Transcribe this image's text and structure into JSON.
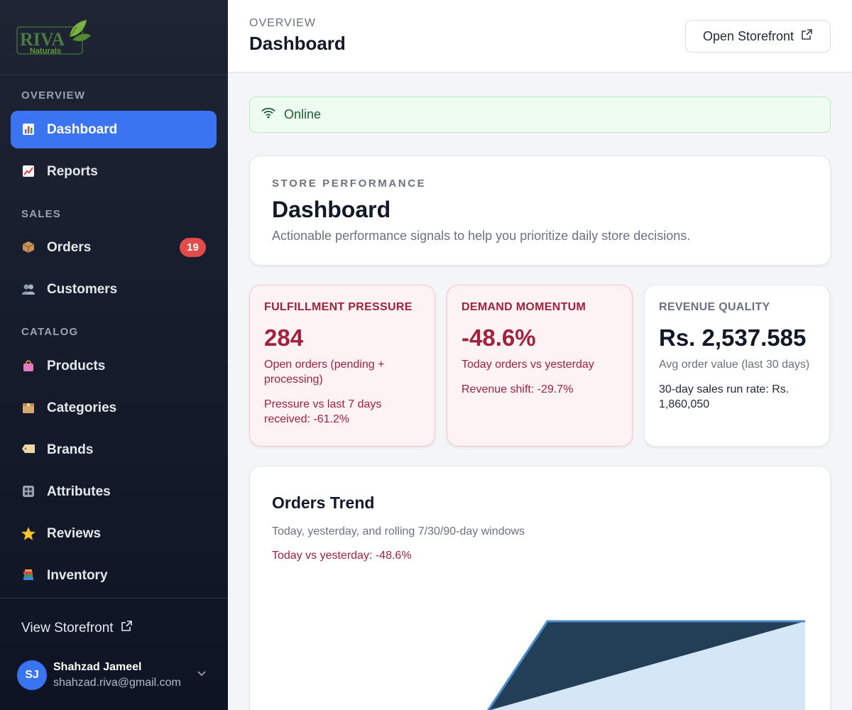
{
  "brand": {
    "logo_word": "RIVA",
    "logo_sub": "Naturals"
  },
  "sidebar": {
    "sections": [
      "OVERVIEW",
      "SALES",
      "CATALOG"
    ],
    "items": [
      {
        "label": "Dashboard",
        "icon": "bar-chart-icon",
        "active": true
      },
      {
        "label": "Reports",
        "icon": "line-chart-icon"
      },
      {
        "label": "Orders",
        "icon": "package-icon",
        "badge": "19"
      },
      {
        "label": "Customers",
        "icon": "users-icon"
      },
      {
        "label": "Products",
        "icon": "shopping-bag-icon"
      },
      {
        "label": "Categories",
        "icon": "box-icon"
      },
      {
        "label": "Brands",
        "icon": "tag-icon"
      },
      {
        "label": "Attributes",
        "icon": "control-knobs-icon"
      },
      {
        "label": "Reviews",
        "icon": "star-icon"
      },
      {
        "label": "Inventory",
        "icon": "books-icon"
      }
    ],
    "view_storefront": "View Storefront",
    "user": {
      "initials": "SJ",
      "name": "Shahzad Jameel",
      "email": "shahzad.riva@gmail.com"
    }
  },
  "header": {
    "crumb": "OVERVIEW",
    "title": "Dashboard",
    "open_storefront": "Open Storefront"
  },
  "status": {
    "label": "Online"
  },
  "hero": {
    "eyebrow": "STORE PERFORMANCE",
    "title": "Dashboard",
    "description": "Actionable performance signals to help you prioritize daily store decisions."
  },
  "kpis": [
    {
      "label": "FULFILLMENT PRESSURE",
      "value": "284",
      "sub": "Open orders (pending + processing)",
      "note": "Pressure vs last 7 days received: -61.2%"
    },
    {
      "label": "DEMAND MOMENTUM",
      "value": "-48.6%",
      "sub": "Today orders vs yesterday",
      "note": "Revenue shift: -29.7%"
    },
    {
      "label": "REVENUE QUALITY",
      "value": "Rs. 2,537.585",
      "sub": "Avg order value (last 30 days)",
      "note": "30-day sales run rate: Rs. 1,860,050"
    }
  ],
  "orders_trend": {
    "title": "Orders Trend",
    "subtitle": "Today, yesterday, and rolling 7/30/90-day windows",
    "note": "Today vs yesterday: -48.6%"
  },
  "colors": {
    "accent": "#3b74f0",
    "alert": "#a3213d",
    "online": "#1f5e34",
    "chart_dark": "#233e57",
    "chart_light": "#d4e7f7",
    "chart_line": "#4a90d0"
  }
}
